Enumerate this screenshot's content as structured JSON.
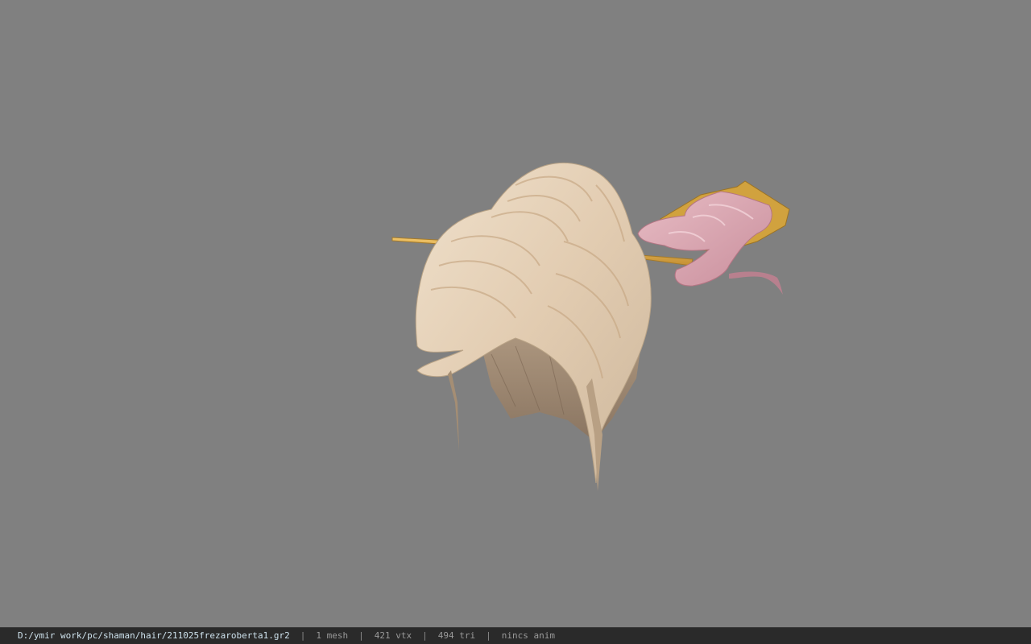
{
  "viewer": {
    "background_color": "#808080",
    "model_name": "hair-model-with-pin"
  },
  "statusbar": {
    "file_path": "D:/ymir work/pc/shaman/hair/211025frezaroberta1.gr2",
    "separator": "|",
    "mesh_count": "1 mesh",
    "vertex_count": "421 vtx",
    "triangle_count": "494 tri",
    "anim_status": "nincs anim"
  },
  "colors": {
    "statusbar_bg": "#2a2a2a",
    "path_text": "#cfe3ee",
    "info_text": "#9a9a9a",
    "hair": "#e8d6bf",
    "hair_shadow": "#9b8670",
    "pin": "#d8a84a",
    "ribbon": "#d9a6b2"
  }
}
